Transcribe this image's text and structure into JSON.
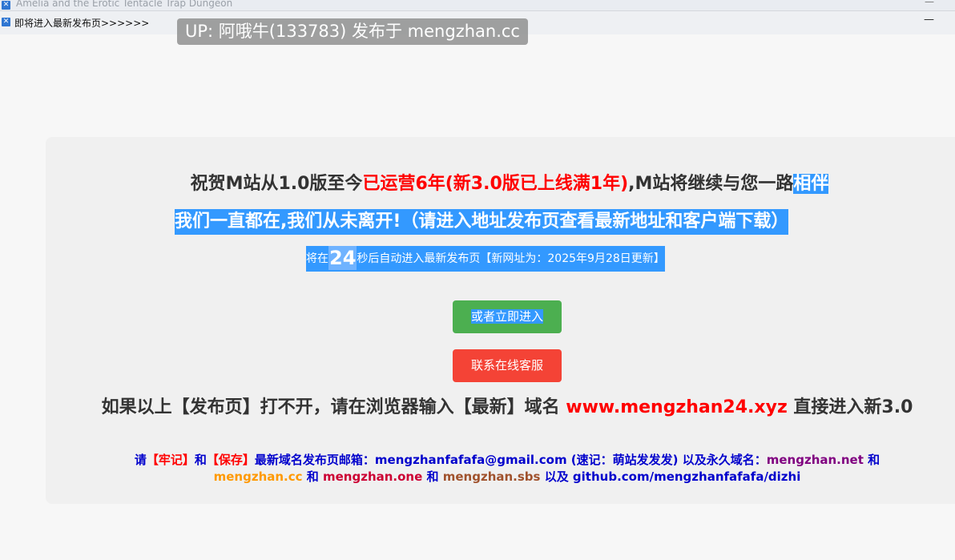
{
  "window": {
    "outer_title": "Amelia and the Erotic Tentacle Trap Dungeon",
    "inner_title": "即将进入最新发布页>>>>>>",
    "minimize_glyph": "—",
    "icon_glyph": "✕"
  },
  "watermark": "UP: 阿哦牛(133783) 发布于 mengzhan.cc",
  "headline": {
    "part1": "祝贺M站从1.0版至今",
    "part2_red": "已运营6年(新3.0版已上线满1年)",
    "part3": ",M站将继续与您一路",
    "part4_selected": "相伴"
  },
  "subheadline": "我们一直都在,我们从未离开!（请进入地址发布页查看最新地址和客户端下载）",
  "countdown_line": {
    "prefix": "将在",
    "seconds": "24",
    "suffix": "秒后自动进入最新发布页【新网址为：2025年9月28日更新】"
  },
  "buttons": {
    "enter_now": "或者立即进入",
    "contact_support": "联系在线客服"
  },
  "fallback_notice": {
    "prefix": "如果以上【发布页】打不开，请在浏览器输入【最新】域名",
    "domain": "www.mengzhan24.xyz",
    "suffix": "直接进入新3.0"
  },
  "footer": {
    "p1": "请",
    "p2": "【牢记】",
    "p3": "和",
    "p4": "【保存】",
    "p5": "最新域名发布页邮箱：mengzhanfafafa@gmail.com (速记：萌站发发发) 以及永久域名：",
    "d1": "mengzhan.net",
    "p6": " 和 ",
    "d2": "mengzhan.cc",
    "p7": " 和 ",
    "d3": "mengzhan.one",
    "p8": " 和 ",
    "d4": "mengzhan.sbs",
    "p9": " 以及 github.com/mengzhanfafafa/dizhi"
  },
  "colors": {
    "selection": "#3399ff",
    "enter_button": "#4caf50",
    "support_button": "#f44336",
    "highlight_red": "#ff0000"
  }
}
